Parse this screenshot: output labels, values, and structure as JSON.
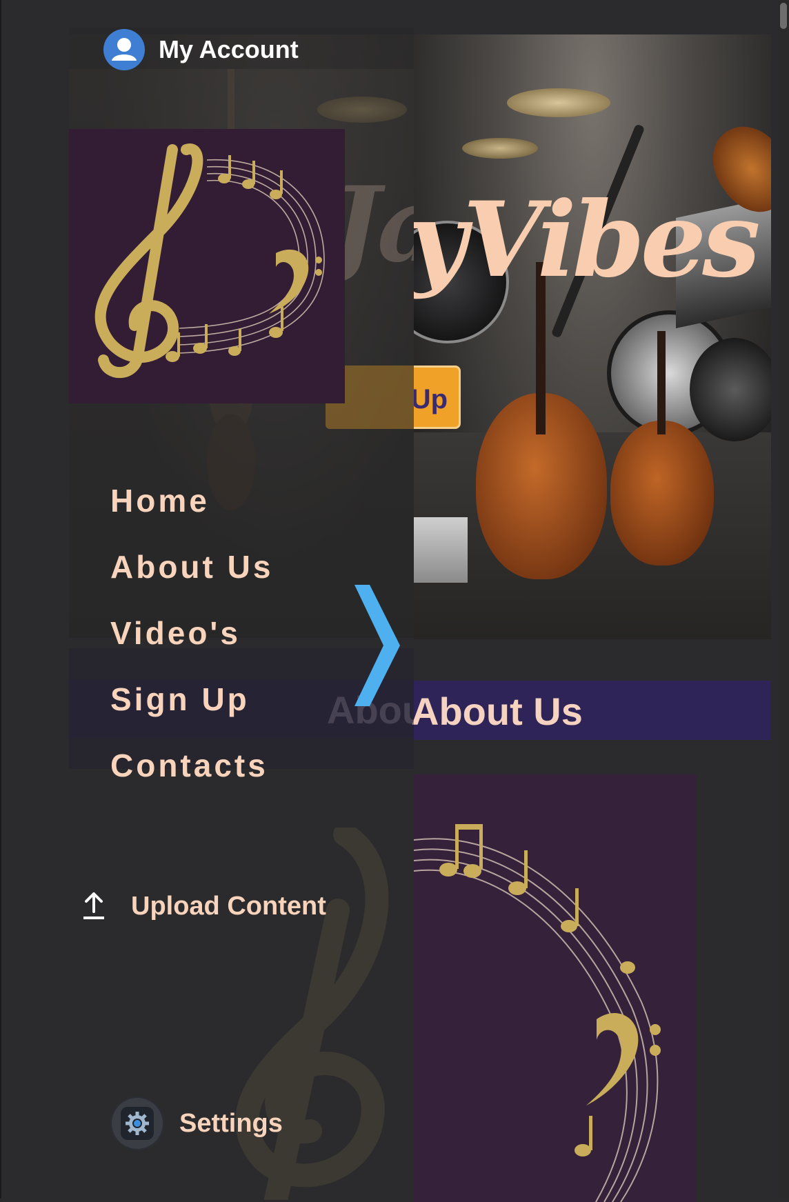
{
  "account": {
    "label": "My Account"
  },
  "hero": {
    "title_fragment": "yVibes",
    "signup_label": "Sign Up"
  },
  "background": {
    "ghost_title": "Jay",
    "ghost_about": "About Us"
  },
  "nav": {
    "items": [
      {
        "label": "Home"
      },
      {
        "label": "About Us"
      },
      {
        "label": "Video's"
      },
      {
        "label": "Sign Up"
      },
      {
        "label": "Contacts"
      }
    ]
  },
  "upload": {
    "label": "Upload Content",
    "icon": "upload-icon"
  },
  "settings": {
    "label": "Settings",
    "icon": "gear-icon"
  },
  "about_section": {
    "heading": "About Us"
  },
  "colors": {
    "background": "#2b2b2d",
    "nav_text": "#f9d4bc",
    "accent_chevron": "#4fb0f0",
    "signup_button": "#f0a228",
    "about_bar": "#2e2457",
    "logo_bg": "#321d35",
    "avatar": "#3f7fd3"
  }
}
